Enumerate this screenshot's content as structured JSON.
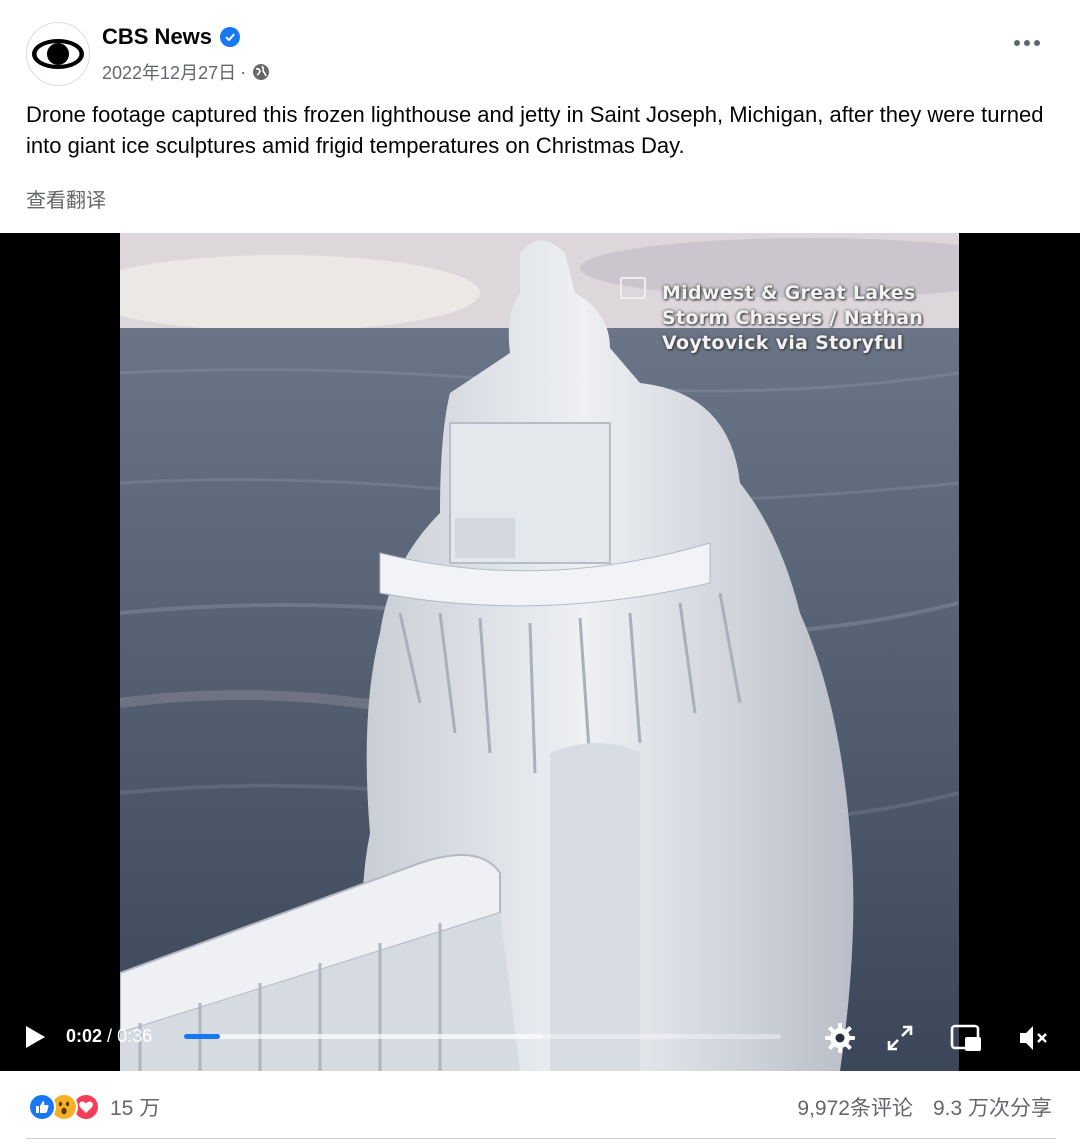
{
  "post": {
    "page_name": "CBS News",
    "date": "2022年12月27日",
    "dot": "·",
    "caption": "Drone footage captured this frozen lighthouse and jetty in Saint Joseph, Michigan, after they were turned into giant ice sculptures amid frigid temperatures on Christmas Day.",
    "translate_label": "查看翻译"
  },
  "video": {
    "watermark": [
      "Midwest & Great Lakes",
      "Storm Chasers / Nathan",
      "Voytovick via Storyful"
    ],
    "current_time": "0:02",
    "separator": "/",
    "duration": "0:36",
    "progress_fraction": 0.06,
    "buffered_fraction": 0.6
  },
  "footer": {
    "reaction_count": "15 万",
    "comments": "9,972条评论",
    "shares": "9.3 万次分享"
  },
  "colors": {
    "brand_blue": "#1877f2",
    "secondary_text": "#65676b",
    "like": "#1877f2",
    "love": "#f33e58",
    "wow": "#f7b125"
  },
  "icons": {
    "avatar": "cbs-eye-logo",
    "verified": "verified-badge-icon",
    "audience": "globe-icon",
    "more": "more-options-icon",
    "play": "play-icon",
    "settings": "gear-icon",
    "fullscreen": "expand-icon",
    "pip": "picture-in-picture-icon",
    "mute": "muted-speaker-icon"
  }
}
